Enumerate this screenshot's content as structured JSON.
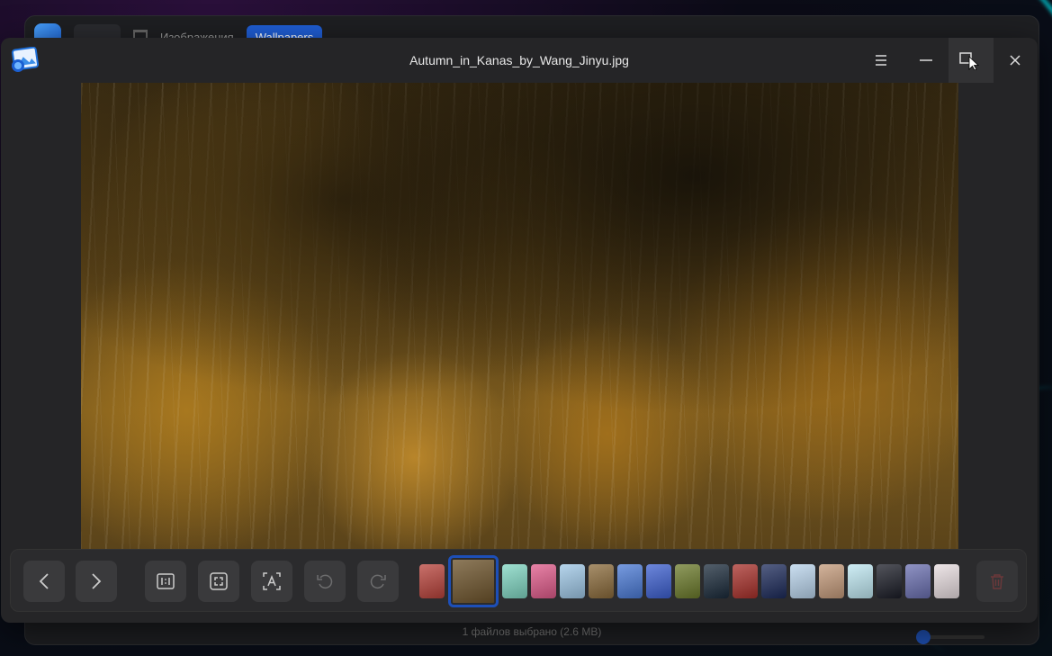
{
  "background_window": {
    "breadcrumbs": [
      "Изображения",
      "Wallpapers"
    ],
    "status_text": "1 файлов выбрано (2.6 MB)"
  },
  "viewer": {
    "title": "Autumn_in_Kanas_by_Wang_Jinyu.jpg",
    "title_buttons": [
      "menu-icon",
      "minimize-icon",
      "maximize-icon",
      "close-icon"
    ]
  },
  "toolbar": {
    "buttons": [
      {
        "name": "previous",
        "icon": "chevron-left-icon",
        "enabled": true
      },
      {
        "name": "next",
        "icon": "chevron-right-icon",
        "enabled": true
      },
      {
        "name": "actual-size",
        "icon": "one-to-one-icon",
        "enabled": true
      },
      {
        "name": "fit-window",
        "icon": "fit-screen-icon",
        "enabled": true
      },
      {
        "name": "ocr",
        "icon": "text-recognition-icon",
        "enabled": true
      },
      {
        "name": "rotate-left",
        "icon": "rotate-ccw-icon",
        "enabled": false
      },
      {
        "name": "rotate-right",
        "icon": "rotate-cw-icon",
        "enabled": false
      },
      {
        "name": "delete",
        "icon": "trash-icon",
        "enabled": false
      }
    ],
    "current_thumbnail_index": 1,
    "thumbnail_colors": [
      "#b8423a",
      "#6b5128",
      "#7fd6c2",
      "#e05a8a",
      "#9ec7e6",
      "#8a6a3a",
      "#4a7ad6",
      "#3c5fd0",
      "#6b7a2a",
      "#1a2a3a",
      "#a8302a",
      "#1c2a5a",
      "#b9d4ec",
      "#c49a7a",
      "#bfe8f2",
      "#1a1c26",
      "#6a6fb0",
      "#e8dde0"
    ]
  },
  "colors": {
    "accent": "#1f5ed6",
    "window_bg": "#252527",
    "toolbar_bg": "#2b2b2d"
  }
}
